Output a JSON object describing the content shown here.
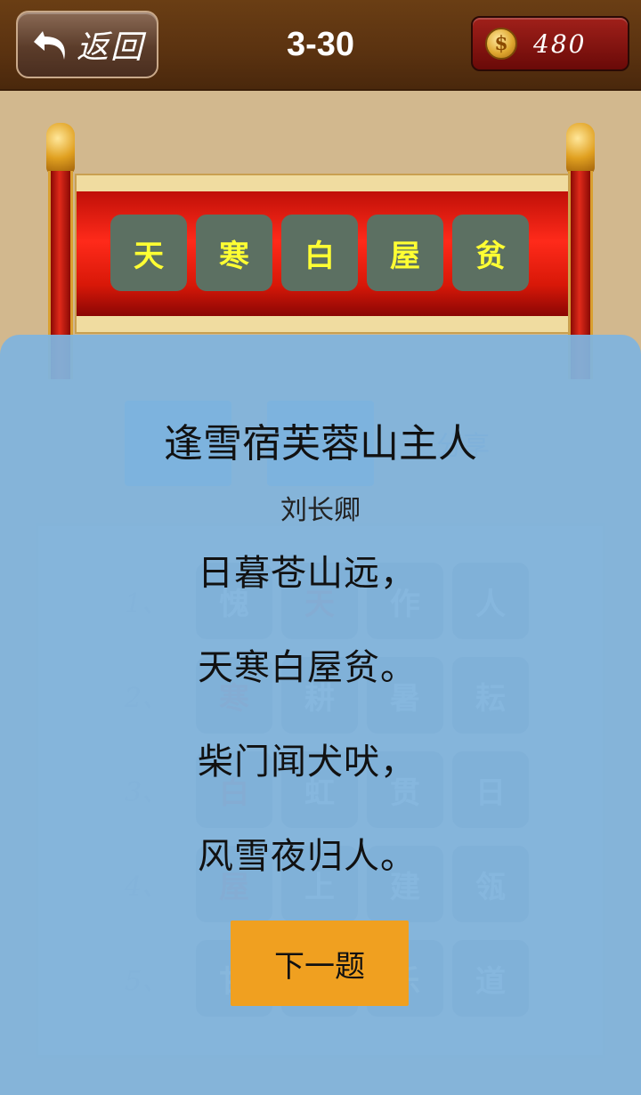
{
  "header": {
    "back_label": "返回",
    "level": "3-30",
    "coins": "480",
    "coin_symbol": "$"
  },
  "answer_tiles": [
    "天",
    "寒",
    "白",
    "屋",
    "贫"
  ],
  "background_board": {
    "share_label": "分享",
    "row_numbers": [
      "1、",
      "2、",
      "3、",
      "4、",
      "5、"
    ],
    "rows": [
      [
        "愧",
        "天",
        "作",
        "人"
      ],
      [
        "寒",
        "耕",
        "暑",
        "耘"
      ],
      [
        "白",
        "虹",
        "贯",
        "日"
      ],
      [
        "屋",
        "上",
        "建",
        "瓴"
      ],
      [
        "甘",
        "贫",
        "乐",
        "道"
      ]
    ]
  },
  "dialog": {
    "title": "逢雪宿芙蓉山主人",
    "author": "刘长卿",
    "lines": [
      "日暮苍山远，",
      "天寒白屋贫。",
      "柴门闻犬吠，",
      "风雪夜归人。"
    ],
    "next_label": "下一题"
  },
  "colors": {
    "topbar": "#5a3210",
    "answer_tile": "#5c7062",
    "answer_text": "#ffff33",
    "overlay": "#80b4de",
    "next_button": "#f0a020"
  }
}
